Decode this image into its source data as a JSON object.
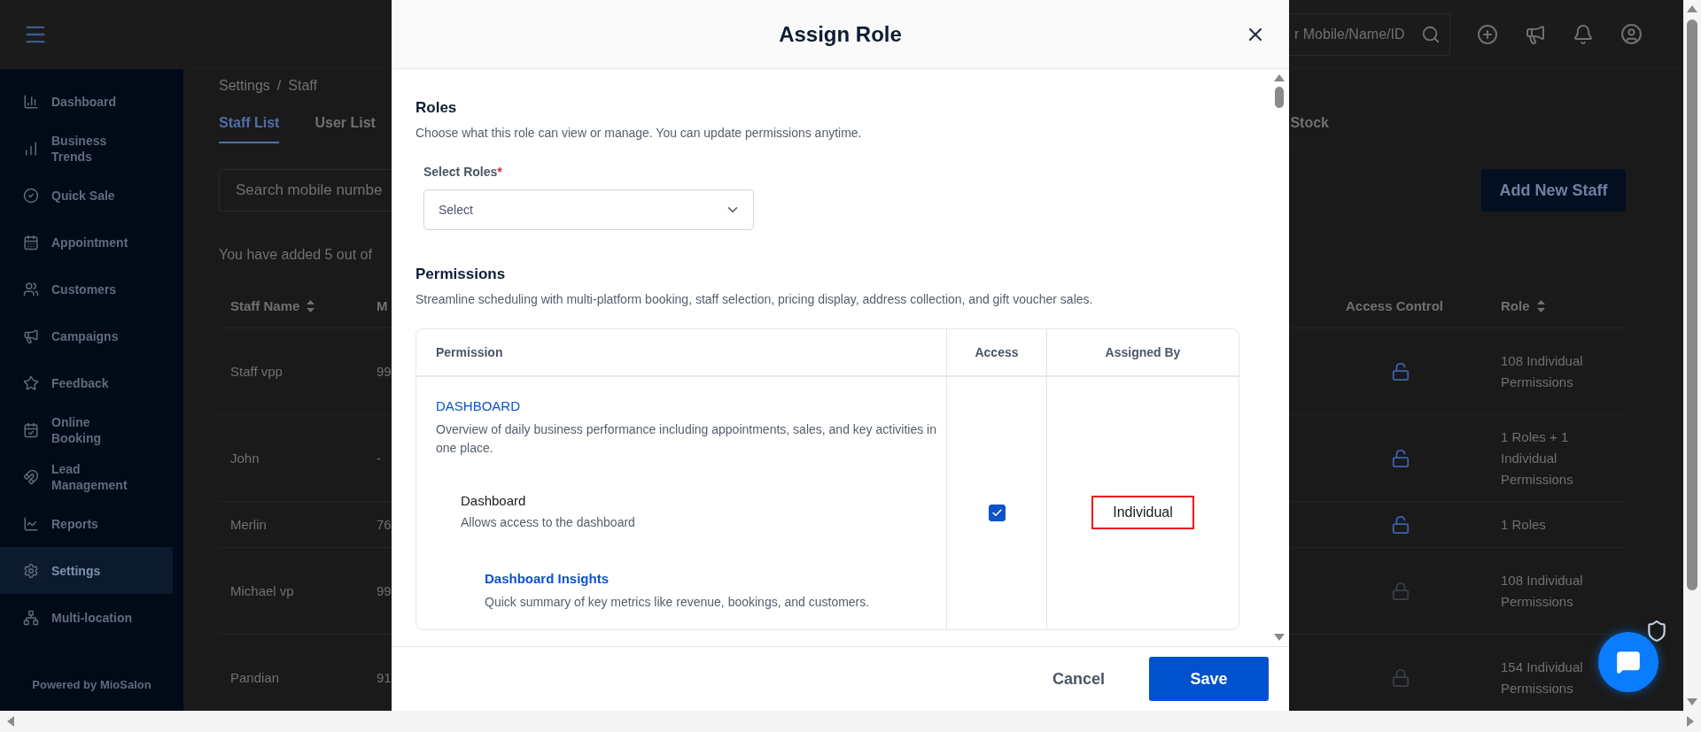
{
  "header": {
    "search_placeholder": "r Mobile/Name/ID"
  },
  "sidebar": {
    "items": [
      {
        "label": "Dashboard",
        "selected": false
      },
      {
        "label": "Business Trends",
        "selected": false
      },
      {
        "label": "Quick Sale",
        "selected": false
      },
      {
        "label": "Appointment",
        "selected": false
      },
      {
        "label": "Customers",
        "selected": false
      },
      {
        "label": "Campaigns",
        "selected": false
      },
      {
        "label": "Feedback",
        "selected": false
      },
      {
        "label": "Online Booking",
        "selected": false
      },
      {
        "label": "Lead Management",
        "selected": false
      },
      {
        "label": "Reports",
        "selected": false
      },
      {
        "label": "Settings",
        "selected": true
      },
      {
        "label": "Multi-location",
        "selected": false
      }
    ],
    "footer": "Powered by MioSalon"
  },
  "breadcrumb": [
    "Settings",
    "/",
    "Staff"
  ],
  "tabs": [
    {
      "label": "Staff List",
      "selected": true
    },
    {
      "label": "User List",
      "selected": false
    }
  ],
  "tab_cut": "Stock",
  "staff_search": {
    "placeholder": "Search mobile numbe"
  },
  "add_button": "Add New Staff",
  "summary": "You have added 5 out of",
  "staff_table": {
    "columns": [
      "Staff Name",
      "M",
      "Access Control",
      "Role"
    ],
    "rows": [
      {
        "name": "Staff vpp",
        "column_2": "99",
        "locked": false,
        "role": "108 Individual Permissions"
      },
      {
        "name": "John",
        "column_2": "-",
        "locked": false,
        "role": "1 Roles + 1 Individual Permissions"
      },
      {
        "name": "Merlin",
        "column_2": "76",
        "locked": false,
        "role": "1 Roles"
      },
      {
        "name": "Michael vp",
        "column_2": "99",
        "locked": true,
        "role": "108 Individual Permissions"
      },
      {
        "name": "Pandian",
        "column_2": "91",
        "locked": true,
        "role": "154 Individual Permissions"
      }
    ]
  },
  "modal": {
    "title": "Assign Role",
    "roles": {
      "heading": "Roles",
      "description": "Choose what this role can view or manage. You can update permissions anytime.",
      "label": "Select Roles",
      "required_mark": "*",
      "placeholder": "Select"
    },
    "permissions": {
      "heading": "Permissions",
      "description": "Streamline scheduling with multi-platform booking, staff selection, pricing display, address collection, and gift voucher sales.",
      "columns": [
        "Permission",
        "Access",
        "Assigned By"
      ],
      "groups": [
        {
          "title": "DASHBOARD",
          "description": "Overview of daily business performance including appointments, sales, and key activities in one place.",
          "items": [
            {
              "name": "Dashboard",
              "description": "Allows access to the dashboard",
              "access": true,
              "assigned_by": "Individual",
              "highlighted": true,
              "children": [
                {
                  "name": "Dashboard Insights",
                  "description": "Quick summary of key metrics like revenue, bookings, and customers."
                }
              ]
            }
          ]
        }
      ]
    },
    "buttons": [
      {
        "label": "Cancel",
        "kind": "secondary"
      },
      {
        "label": "Save",
        "kind": "primary"
      }
    ]
  }
}
